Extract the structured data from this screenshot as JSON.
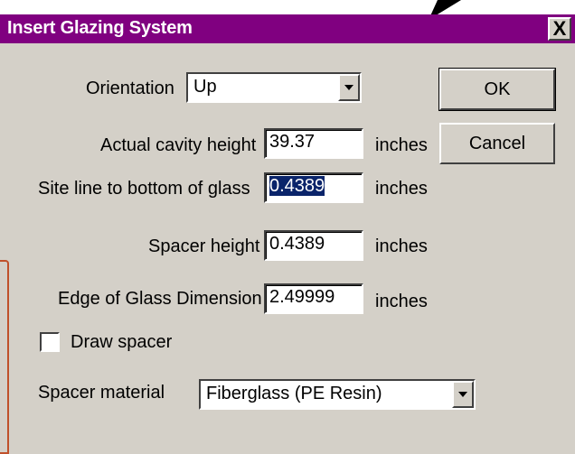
{
  "window": {
    "title": "Insert Glazing System"
  },
  "title_bar": {
    "close_label": "X"
  },
  "form": {
    "orientation": {
      "label": "Orientation",
      "value": "Up"
    },
    "cavity_height": {
      "label": "Actual cavity height",
      "value": "39.37",
      "unit": "inches"
    },
    "site_line": {
      "label": "Site line to bottom of glass",
      "value": "0.4389",
      "unit": "inches"
    },
    "spacer_height": {
      "label": "Spacer height",
      "value": "0.4389",
      "unit": "inches"
    },
    "edge_of_glass": {
      "label": "Edge of Glass Dimension",
      "value": "2.49999",
      "unit": "inches"
    },
    "draw_spacer": {
      "label": "Draw spacer",
      "checked": false
    },
    "spacer_material": {
      "label": "Spacer material",
      "value": "Fiberglass (PE Resin)"
    }
  },
  "buttons": {
    "ok": "OK",
    "cancel": "Cancel"
  },
  "colors": {
    "title_bar": "#800080",
    "dialog": "#d4d0c8",
    "selection": "#0a246a"
  }
}
